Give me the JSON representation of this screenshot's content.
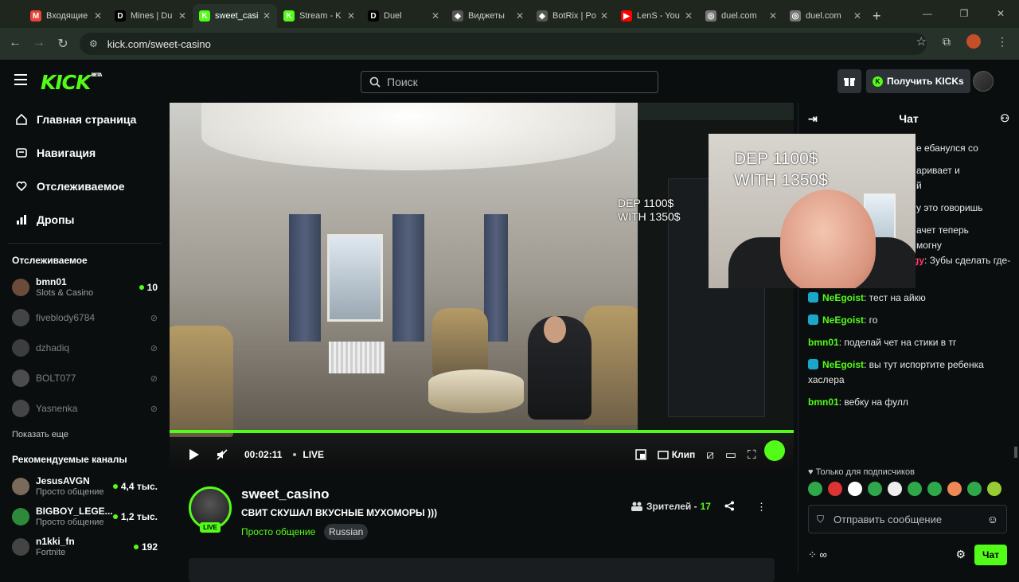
{
  "browser": {
    "tabs": [
      {
        "label": "Входящие",
        "fav": "M",
        "color": "#ea4335"
      },
      {
        "label": "Mines | Du",
        "fav": "D",
        "color": "#000000"
      },
      {
        "label": "sweet_casi",
        "fav": "K",
        "color": "#53fc18",
        "active": true
      },
      {
        "label": "Stream - K",
        "fav": "K",
        "color": "#53fc18"
      },
      {
        "label": "Duel",
        "fav": "D",
        "color": "#000000"
      },
      {
        "label": "Виджеты",
        "fav": "◆",
        "color": "#555555"
      },
      {
        "label": "BotRix | Po",
        "fav": "◆",
        "color": "#555555"
      },
      {
        "label": "LenS - You",
        "fav": "▶",
        "color": "#ff0000"
      },
      {
        "label": "duel.com",
        "fav": "◎",
        "color": "#777777"
      },
      {
        "label": "duel.com",
        "fav": "◎",
        "color": "#777777"
      }
    ],
    "url": "kick.com/sweet-casino"
  },
  "header": {
    "logo": "KICK",
    "logo_badge": "BETA",
    "search_placeholder": "Поиск",
    "get_kicks": "Получить KICKs",
    "accent": "#53fc18"
  },
  "sidebar": {
    "nav": [
      {
        "label": "Главная страница",
        "icon": "home-icon"
      },
      {
        "label": "Навигация",
        "icon": "compass-icon"
      },
      {
        "label": "Отслеживаемое",
        "icon": "heart-icon"
      },
      {
        "label": "Дропы",
        "icon": "drops-icon"
      }
    ],
    "following_title": "Отслеживаемое",
    "following": [
      {
        "name": "bmn01",
        "category": "Slots & Casino",
        "viewers": "10",
        "live": true
      },
      {
        "name": "fiveblody6784",
        "live": false
      },
      {
        "name": "dzhadiq",
        "live": false
      },
      {
        "name": "BOLT077",
        "live": false
      },
      {
        "name": "Yasnenka",
        "live": false
      }
    ],
    "show_more": "Показать еще",
    "recommended_title": "Рекомендуемые каналы",
    "recommended": [
      {
        "name": "JesusAVGN",
        "category": "Просто общение",
        "viewers": "4,4 тыс."
      },
      {
        "name": "BIGBOY_LEGE...",
        "category": "Просто общение",
        "viewers": "1,2 тыс."
      },
      {
        "name": "n1kki_fn",
        "category": "Fortnite",
        "viewers": "192"
      }
    ]
  },
  "player": {
    "time": "00:02:11",
    "live_label": "LIVE",
    "clip_label": "Клип",
    "overlay_line1": "DEP 1100$",
    "overlay_line2": "WITH 1350$",
    "progress": 1.0
  },
  "stream_info": {
    "channel": "sweet_casino",
    "live_badge": "LIVE",
    "title": "СВИТ СКУШАЛ ВКУСНЫЕ МУХОМОРЫ )))",
    "category": "Просто общение",
    "language": "Russian",
    "viewers_label": "Зрителей -",
    "viewers": "17"
  },
  "chat": {
    "title": "Чат",
    "messages": [
      {
        "user": "",
        "text": "е ебанулся со",
        "color": "#ffffff"
      },
      {
        "user": "",
        "text": "аривает и",
        "color": "#ffffff"
      },
      {
        "user": "",
        "text": "й",
        "color": "#ffffff"
      },
      {
        "user": "",
        "text": "у это говоришь",
        "color": "#ffffff"
      },
      {
        "user": "",
        "text": "ачет теперь",
        "color": "#ffffff"
      },
      {
        "user": "",
        "text": "могну",
        "color": "#ffffff"
      },
      {
        "user": "Kwinzees_nebedolagy",
        "text": ": Зубы сделать где-то пол лямчика",
        "color": "#ff3b6b",
        "badge": "#e04aa0"
      },
      {
        "user": "NeEgoist",
        "text": ": тест на айкю",
        "color": "#53fc18",
        "badge": "#1aa7c9"
      },
      {
        "user": "NeEgoist",
        "text": ": го",
        "color": "#53fc18",
        "badge": "#1aa7c9"
      },
      {
        "user": "bmn01",
        "text": ": поделай чет на стики в тг",
        "color": "#53fc18"
      },
      {
        "user": "NeEgoist",
        "text": ": вы тут испортите ребенка хаслера",
        "color": "#53fc18",
        "badge": "#1aa7c9"
      },
      {
        "user": "bmn01",
        "text": ": вебку на фулл",
        "color": "#53fc18"
      }
    ],
    "sub_only": "Только для подписчиков",
    "input_placeholder": "Отправить сообщение",
    "send": "Чат"
  }
}
